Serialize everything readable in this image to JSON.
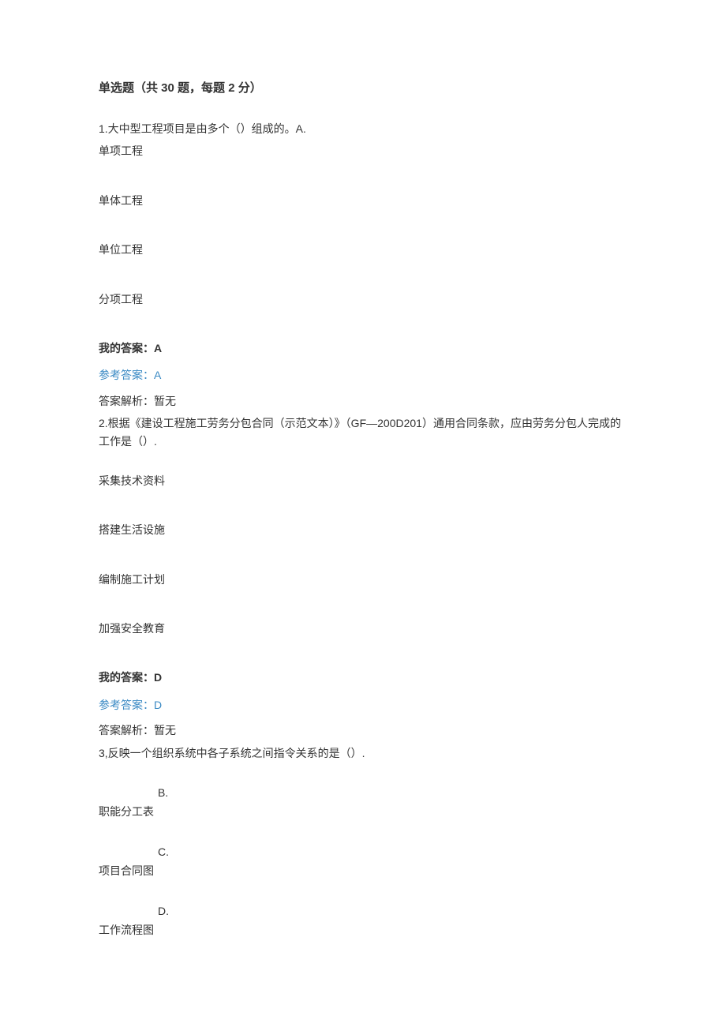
{
  "sectionTitle": "单选题（共 30 题，每题 2 分）",
  "q1": {
    "text": "1.大中型工程项目是由多个（）组成的。A.",
    "optA": "单项工程",
    "optB": "单体工程",
    "optC": "单位工程",
    "optD": "分项工程",
    "myAnswer": "我的答案：A",
    "refAnswer": "参考答案：A",
    "analysis": "答案解析：暂无"
  },
  "q2": {
    "text": "2.根据《建设工程施工劳务分包合同（示范文本）》（GF—200D201）通用合同条款，应由劳务分包人完成的工作是（）.",
    "optA": "采集技术资料",
    "optB": "搭建生活设施",
    "optC": "编制施工计划",
    "optD": "加强安全教育",
    "myAnswer": "我的答案：D",
    "refAnswer": "参考答案：D",
    "analysis": "答案解析：暂无"
  },
  "q3": {
    "text": "3,反映一个组织系统中各子系统之间指令关系的是（）.",
    "labelB": "B.",
    "optB": "职能分工表",
    "labelC": "C.",
    "optC": "项目合同图",
    "labelD": "D.",
    "optD": "工作流程图"
  }
}
